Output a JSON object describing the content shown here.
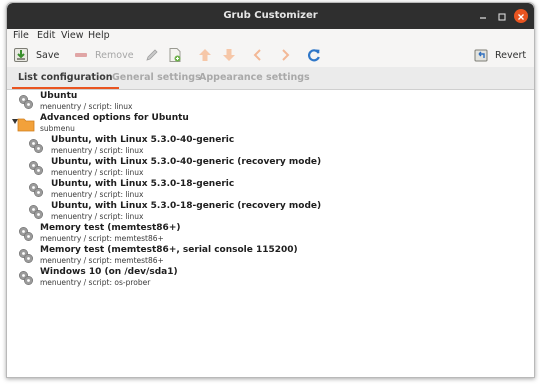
{
  "window": {
    "title": "Grub Customizer"
  },
  "menubar": {
    "items": [
      "File",
      "Edit",
      "View",
      "Help"
    ]
  },
  "toolbar": {
    "save": "Save",
    "remove": "Remove",
    "revert": "Revert"
  },
  "tabs": {
    "list": "List configuration",
    "general": "General settings",
    "appearance": "Appearance settings"
  },
  "entries": [
    {
      "title": "Ubuntu",
      "subtitle": "menuentry / script: linux"
    },
    {
      "title": "Advanced options for Ubuntu",
      "subtitle": "submenu"
    },
    {
      "title": "Ubuntu, with Linux 5.3.0-40-generic",
      "subtitle": "menuentry / script: linux"
    },
    {
      "title": "Ubuntu, with Linux 5.3.0-40-generic (recovery mode)",
      "subtitle": "menuentry / script: linux"
    },
    {
      "title": "Ubuntu, with Linux 5.3.0-18-generic",
      "subtitle": "menuentry / script: linux"
    },
    {
      "title": "Ubuntu, with Linux 5.3.0-18-generic (recovery mode)",
      "subtitle": "menuentry / script: linux"
    },
    {
      "title": "Memory test (memtest86+)",
      "subtitle": "menuentry / script: memtest86+"
    },
    {
      "title": "Memory test (memtest86+, serial console 115200)",
      "subtitle": "menuentry / script: memtest86+"
    },
    {
      "title": "Windows 10 (on /dev/sda1)",
      "subtitle": "menuentry / script: os-prober"
    }
  ],
  "colors": {
    "accent": "#e95420",
    "titlebar": "#2f2f2f",
    "folder": "#f2a13a"
  }
}
